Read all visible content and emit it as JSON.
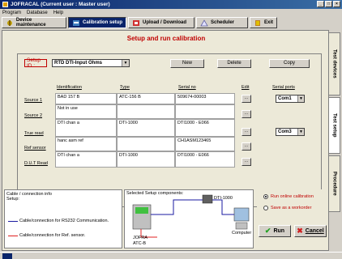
{
  "window": {
    "title": "JOFRACAL (Current user : Master user)",
    "controls": [
      "_",
      "□",
      "×"
    ]
  },
  "menu": [
    "Program",
    "Database",
    "Help"
  ],
  "toolbar": {
    "device_maintenance": "Device maintenance",
    "calibration_setup": "Calibration setup",
    "upload_download": "Upload / Download",
    "scheduler": "Scheduler",
    "exit": "Exit"
  },
  "page": {
    "title": "Setup and run calibration"
  },
  "setup": {
    "label": "Setup ID :",
    "value": "RTD DTI-Input Ohms",
    "new_btn": "New",
    "delete_btn": "Delete",
    "copy_btn": "Copy"
  },
  "table": {
    "headers": {
      "identification": "Identification",
      "type": "Type",
      "serial": "Serial no",
      "edit": "Edit",
      "ports": "Serial ports"
    },
    "rows": [
      {
        "label": "Source 1",
        "identification": "BAD 157 B",
        "type": "ATC-156 B",
        "serial": "509674-00003",
        "port": "Com1"
      },
      {
        "label": "Source 2",
        "identification": "Not in use",
        "type": "",
        "serial": "",
        "port": ""
      },
      {
        "label": "True read",
        "identification": "DTI chan a",
        "type": "DTI-1000",
        "serial": "DTI1000 - E066",
        "port": "Com3"
      },
      {
        "label": "Ref sensor",
        "identification": "hanc asm ref",
        "type": "",
        "serial": "CH1ASM123465",
        "port": ""
      },
      {
        "label": "D.U.T Read",
        "identification": "DTI chan a",
        "type": "DTI-1000",
        "serial": "DTI1000 - E066",
        "port": ""
      }
    ],
    "edit_btn": "..."
  },
  "info": {
    "title": "Cable / connection info",
    "subtitle": "Setup:",
    "legend_rs232": "Cable/connection for RS232 Communication.",
    "legend_ref": "Cable/connection for Ref. sensor.",
    "colors": {
      "rs232": "#1a1aa0",
      "ref": "#e02020"
    }
  },
  "components": {
    "title": "Selected Setup components:",
    "dti_label": "DTI-1000",
    "computer_label": "Computer",
    "jofra_label_1": "JOFRA",
    "jofra_label_2": "ATC-B"
  },
  "options": {
    "run_online": "Run online calibration",
    "save_workorder": "Save as a workorder",
    "run_btn": "Run",
    "cancel_btn": "Cancel"
  },
  "sidetabs": [
    "Test devices",
    "Test setup",
    "Procedure"
  ]
}
